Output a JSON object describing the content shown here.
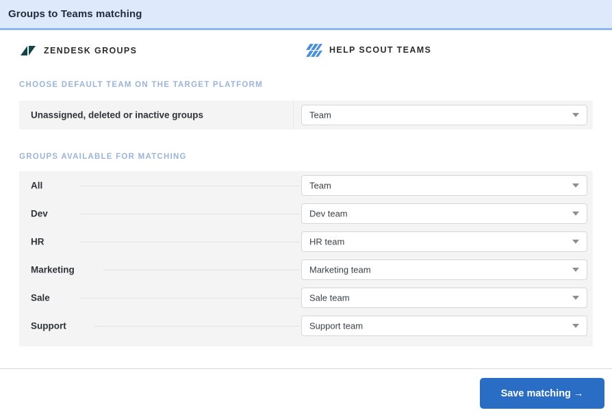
{
  "header": {
    "title": "Groups to Teams matching"
  },
  "brands": {
    "source": {
      "label": "ZENDESK GROUPS",
      "icon": "zendesk-logo-icon",
      "color": "#12444a"
    },
    "target": {
      "label": "HELP SCOUT TEAMS",
      "icon": "helpscout-logo-icon",
      "color": "#4a90d9"
    }
  },
  "sections": {
    "default_caption": "CHOOSE DEFAULT TEAM ON THE TARGET PLATFORM",
    "matching_caption": "GROUPS AVAILABLE FOR MATCHING"
  },
  "default_row": {
    "label": "Unassigned, deleted or inactive groups",
    "select_value": "Team"
  },
  "matching_rows": [
    {
      "group": "All",
      "team": "Team"
    },
    {
      "group": "Dev",
      "team": "Dev team"
    },
    {
      "group": "HR",
      "team": "HR team"
    },
    {
      "group": "Marketing",
      "team": "Marketing team"
    },
    {
      "group": "Sale",
      "team": "Sale team"
    },
    {
      "group": "Support",
      "team": "Support team"
    }
  ],
  "footer": {
    "save_label": "Save matching →"
  },
  "colors": {
    "header_bg": "#deeafc",
    "header_rule": "#8cb6f0",
    "panel_bg": "#f4f4f5",
    "caption": "#9bb4d8",
    "primary_button": "#2a6dc4"
  }
}
